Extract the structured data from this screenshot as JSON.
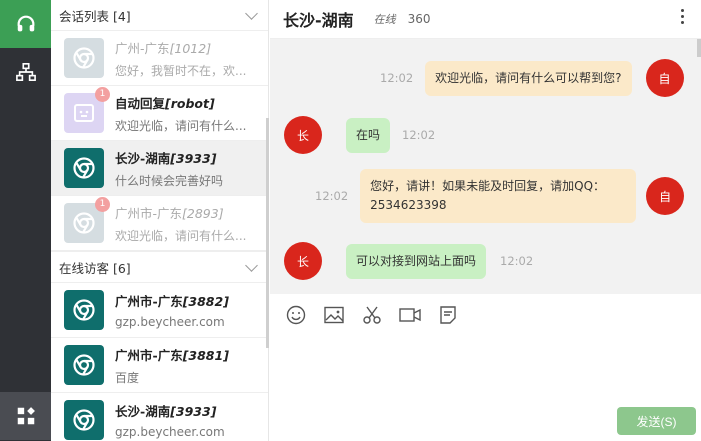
{
  "sidebar": {
    "icons": [
      "headset-icon",
      "sitemap-icon",
      "apps-icon"
    ]
  },
  "conversations": {
    "header": "会话列表 [4]",
    "items": [
      {
        "name": "广州-广东",
        "id": "[1012]",
        "preview": "您好，我暂时不在，欢...",
        "badge": "",
        "style": "dim",
        "avatar": "gray"
      },
      {
        "name": "自动回复",
        "id": "[robot]",
        "preview": "欢迎光临，请问有什么...",
        "badge": "1",
        "style": "",
        "avatar": "lav"
      },
      {
        "name": "长沙-湖南",
        "id": "[3933]",
        "preview": "什么时候会完善好吗",
        "badge": "",
        "style": "active",
        "avatar": "teal"
      },
      {
        "name": "广州市-广东",
        "id": "[2893]",
        "preview": "欢迎光临，请问有什么...",
        "badge": "1",
        "style": "dim",
        "avatar": "gray"
      }
    ]
  },
  "visitors": {
    "header": "在线访客 [6]",
    "items": [
      {
        "name": "广州市-广东",
        "id": "[3882]",
        "preview": "gzp.beycheer.com"
      },
      {
        "name": "广州市-广东",
        "id": "[3881]",
        "preview": "百度"
      },
      {
        "name": "长沙-湖南",
        "id": "[3933]",
        "preview": "gzp.beycheer.com"
      }
    ]
  },
  "chat": {
    "title": "长沙-湖南",
    "status": "在线",
    "count": "360",
    "messages": [
      {
        "side": "right",
        "avatar": "自",
        "text": "欢迎光临，请问有什么可以帮到您?",
        "time": "12:02",
        "color": "y"
      },
      {
        "side": "left",
        "avatar": "长",
        "text": "在吗",
        "time": "12:02",
        "color": "g"
      },
      {
        "side": "right",
        "avatar": "自",
        "text": "您好，请讲！如果未能及时回复，请加QQ：2534623398",
        "time": "12:02",
        "color": "y"
      },
      {
        "side": "left",
        "avatar": "长",
        "text": "可以对接到网站上面吗",
        "time": "12:02",
        "color": "g"
      }
    ],
    "send_label": "发送(S)"
  },
  "colors": {
    "accent": "#3c9f55",
    "teal": "#0f6e6c",
    "avatar_red": "#d9261c",
    "send": "#8dc78d"
  }
}
